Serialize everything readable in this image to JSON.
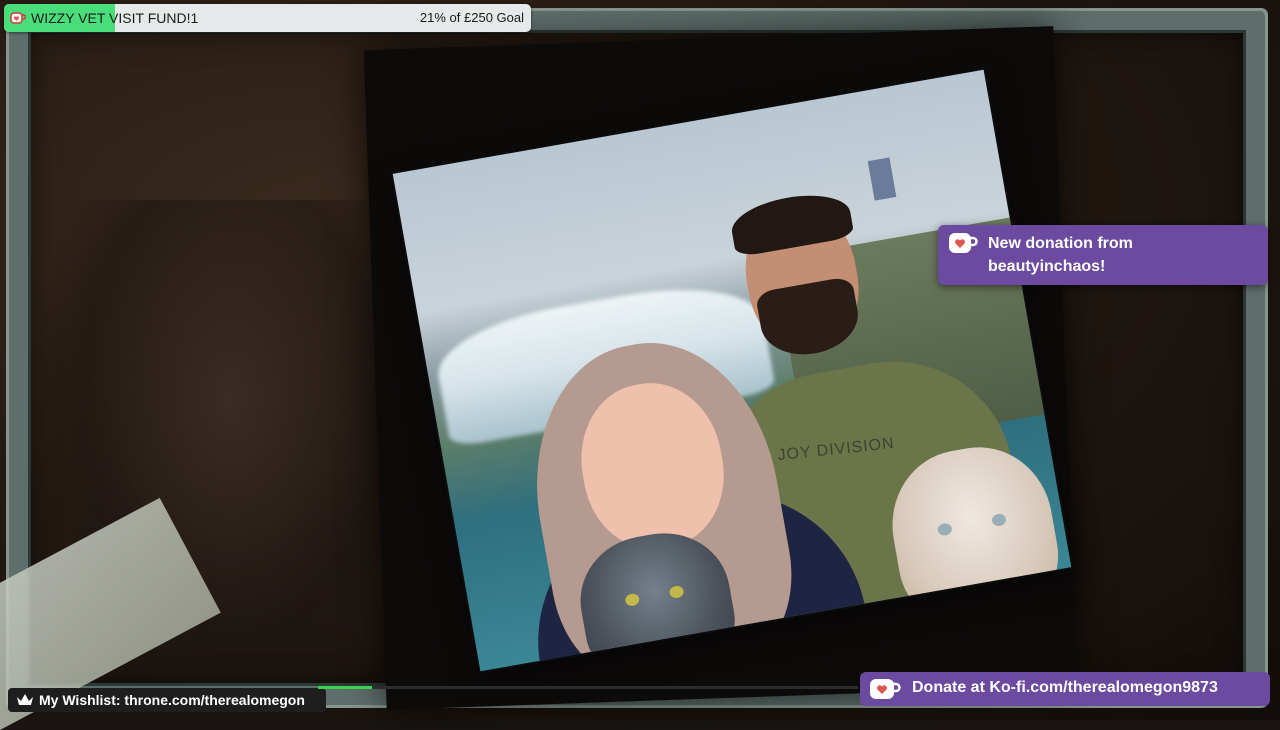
{
  "goal": {
    "title": "WIZZY VET VISIT FUND!1",
    "progress_text": "21% of £250 Goal",
    "percent": 21,
    "icon": "kofi-cup-icon",
    "fill_color": "#4ade7b"
  },
  "alert": {
    "line1": "New donation from",
    "line2": "beautyinchaos!",
    "icon": "kofi-cup-icon",
    "bg_color": "#6b4aa0"
  },
  "photo": {
    "shirt_text": "JOY DIVISION"
  },
  "wishlist": {
    "icon": "crown-icon",
    "label": "My Wishlist: throne.com/therealomegon"
  },
  "kofi": {
    "icon": "kofi-cup-icon",
    "label": "Donate at Ko-fi.com/therealomegon9873",
    "bg_color": "#6b4aa0"
  },
  "stream_progress": {
    "percent": 10,
    "color": "#39d353"
  }
}
